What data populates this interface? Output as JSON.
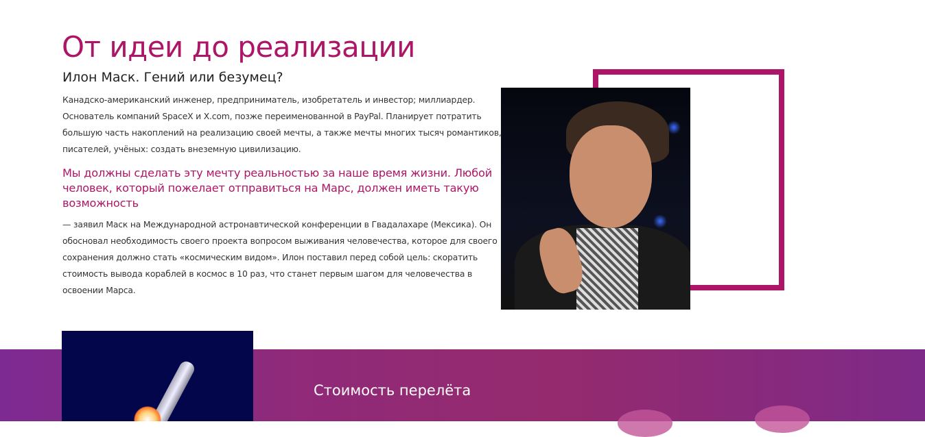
{
  "hero": {
    "title": "От идеи до реализации",
    "subtitle": "Илон Маск. Гений или безумец?",
    "intro": "Канадско-американский инженер, предприниматель, изобретатель и инвестор; миллиардер. Основатель компаний SpaceX и X.com, позже переименованной в PayPal. Планирует потратить большую часть накоплений на реализацию своей мечты, а также мечты многих тысяч романтиков, писателей, учёных: создать внеземную цивилизацию.",
    "quote": "Мы должны сделать эту мечту реальностью за наше время жизни. Любой человек, который пожелает отправиться на Марс, должен иметь такую возможность",
    "after_quote": "— заявил Маск на Международной астронавтической конференции в Гвадалахаре (Мексика). Он обосновал необходимость своего проекта вопросом выживания человечества, которое для своего сохранения должно стать «космическим видом». Илон поставил перед собой цель: скоратить стоимость вывода кораблей в космос в 10 раз, что станет первым шагом для человечества в освоении Марса."
  },
  "cost_section": {
    "title": "Стоимость перелёта"
  },
  "colors": {
    "accent": "#ad1566",
    "band": "#8f2a7a"
  }
}
